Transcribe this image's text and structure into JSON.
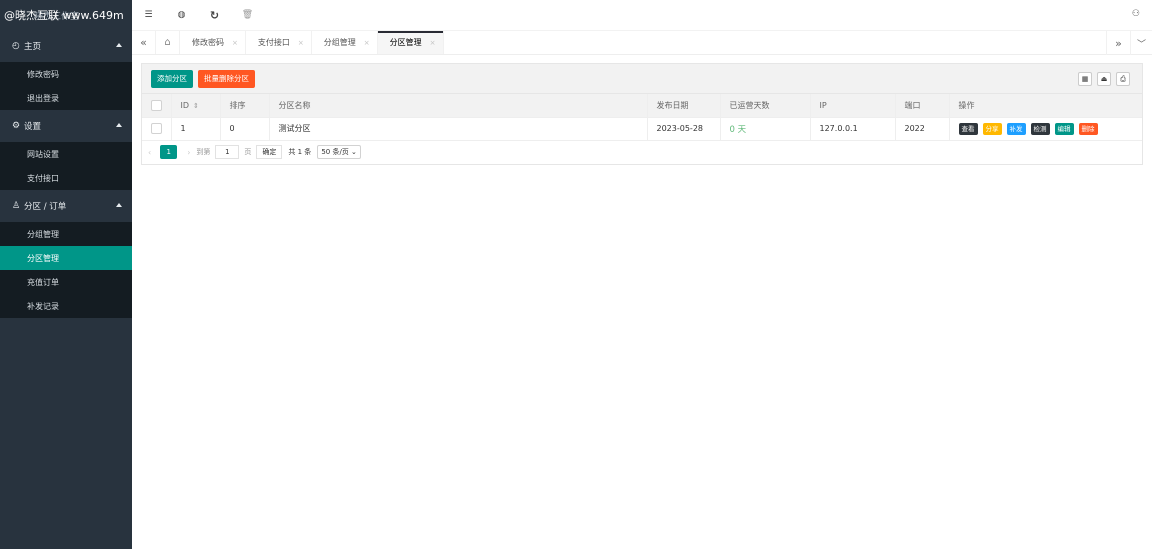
{
  "brand": {
    "watermark": "@晓杰互联 www.649m",
    "subtitle": "晓杰工作室"
  },
  "sidebar": {
    "groups": [
      {
        "title": "主页",
        "icon": "dashboard-icon",
        "items": [
          {
            "label": "修改密码"
          },
          {
            "label": "退出登录"
          }
        ]
      },
      {
        "title": "设置",
        "icon": "gear-icon",
        "items": [
          {
            "label": "网站设置"
          },
          {
            "label": "支付接口"
          }
        ]
      },
      {
        "title": "分区 / 订单",
        "icon": "user-icon",
        "items": [
          {
            "label": "分组管理"
          },
          {
            "label": "分区管理",
            "active": true
          },
          {
            "label": "充值订单"
          },
          {
            "label": "补发记录"
          }
        ]
      }
    ]
  },
  "topbar": {
    "icons": [
      "menu-toggle-icon",
      "globe-icon",
      "refresh-icon",
      "trash-icon"
    ],
    "right_icon": "theme-icon"
  },
  "tabs": {
    "items": [
      {
        "label": "修改密码",
        "close": "×"
      },
      {
        "label": "支付接口",
        "close": "×"
      },
      {
        "label": "分组管理",
        "close": "×"
      },
      {
        "label": "分区管理",
        "close": "×",
        "active": true
      }
    ]
  },
  "toolbar": {
    "add_label": "添加分区",
    "batch_delete_label": "批量删除分区"
  },
  "table": {
    "columns": [
      "",
      "ID",
      "排序",
      "分区名称",
      "发布日期",
      "已运营天数",
      "IP",
      "端口",
      "操作"
    ],
    "rows": [
      {
        "id": "1",
        "sort": "0",
        "name": "测试分区",
        "date": "2023-05-28",
        "days": "0 天",
        "ip": "127.0.0.1",
        "port": "2022"
      }
    ],
    "actions": [
      {
        "label": "查看",
        "color": "#2f363c"
      },
      {
        "label": "分享",
        "color": "#ffb800"
      },
      {
        "label": "补发",
        "color": "#1e9fff"
      },
      {
        "label": "检测",
        "color": "#2f363c"
      },
      {
        "label": "编辑",
        "color": "#009688"
      },
      {
        "label": "删除",
        "color": "#ff5722"
      }
    ]
  },
  "pager": {
    "current": "1",
    "goto_label": "到第",
    "page_input": "1",
    "page_unit": "页",
    "confirm_label": "确定",
    "total_label": "共 1 条",
    "page_size": "50 条/页"
  },
  "colors": {
    "sidebar_bg": "#28333e",
    "accent": "#009688",
    "danger": "#ff5722"
  }
}
